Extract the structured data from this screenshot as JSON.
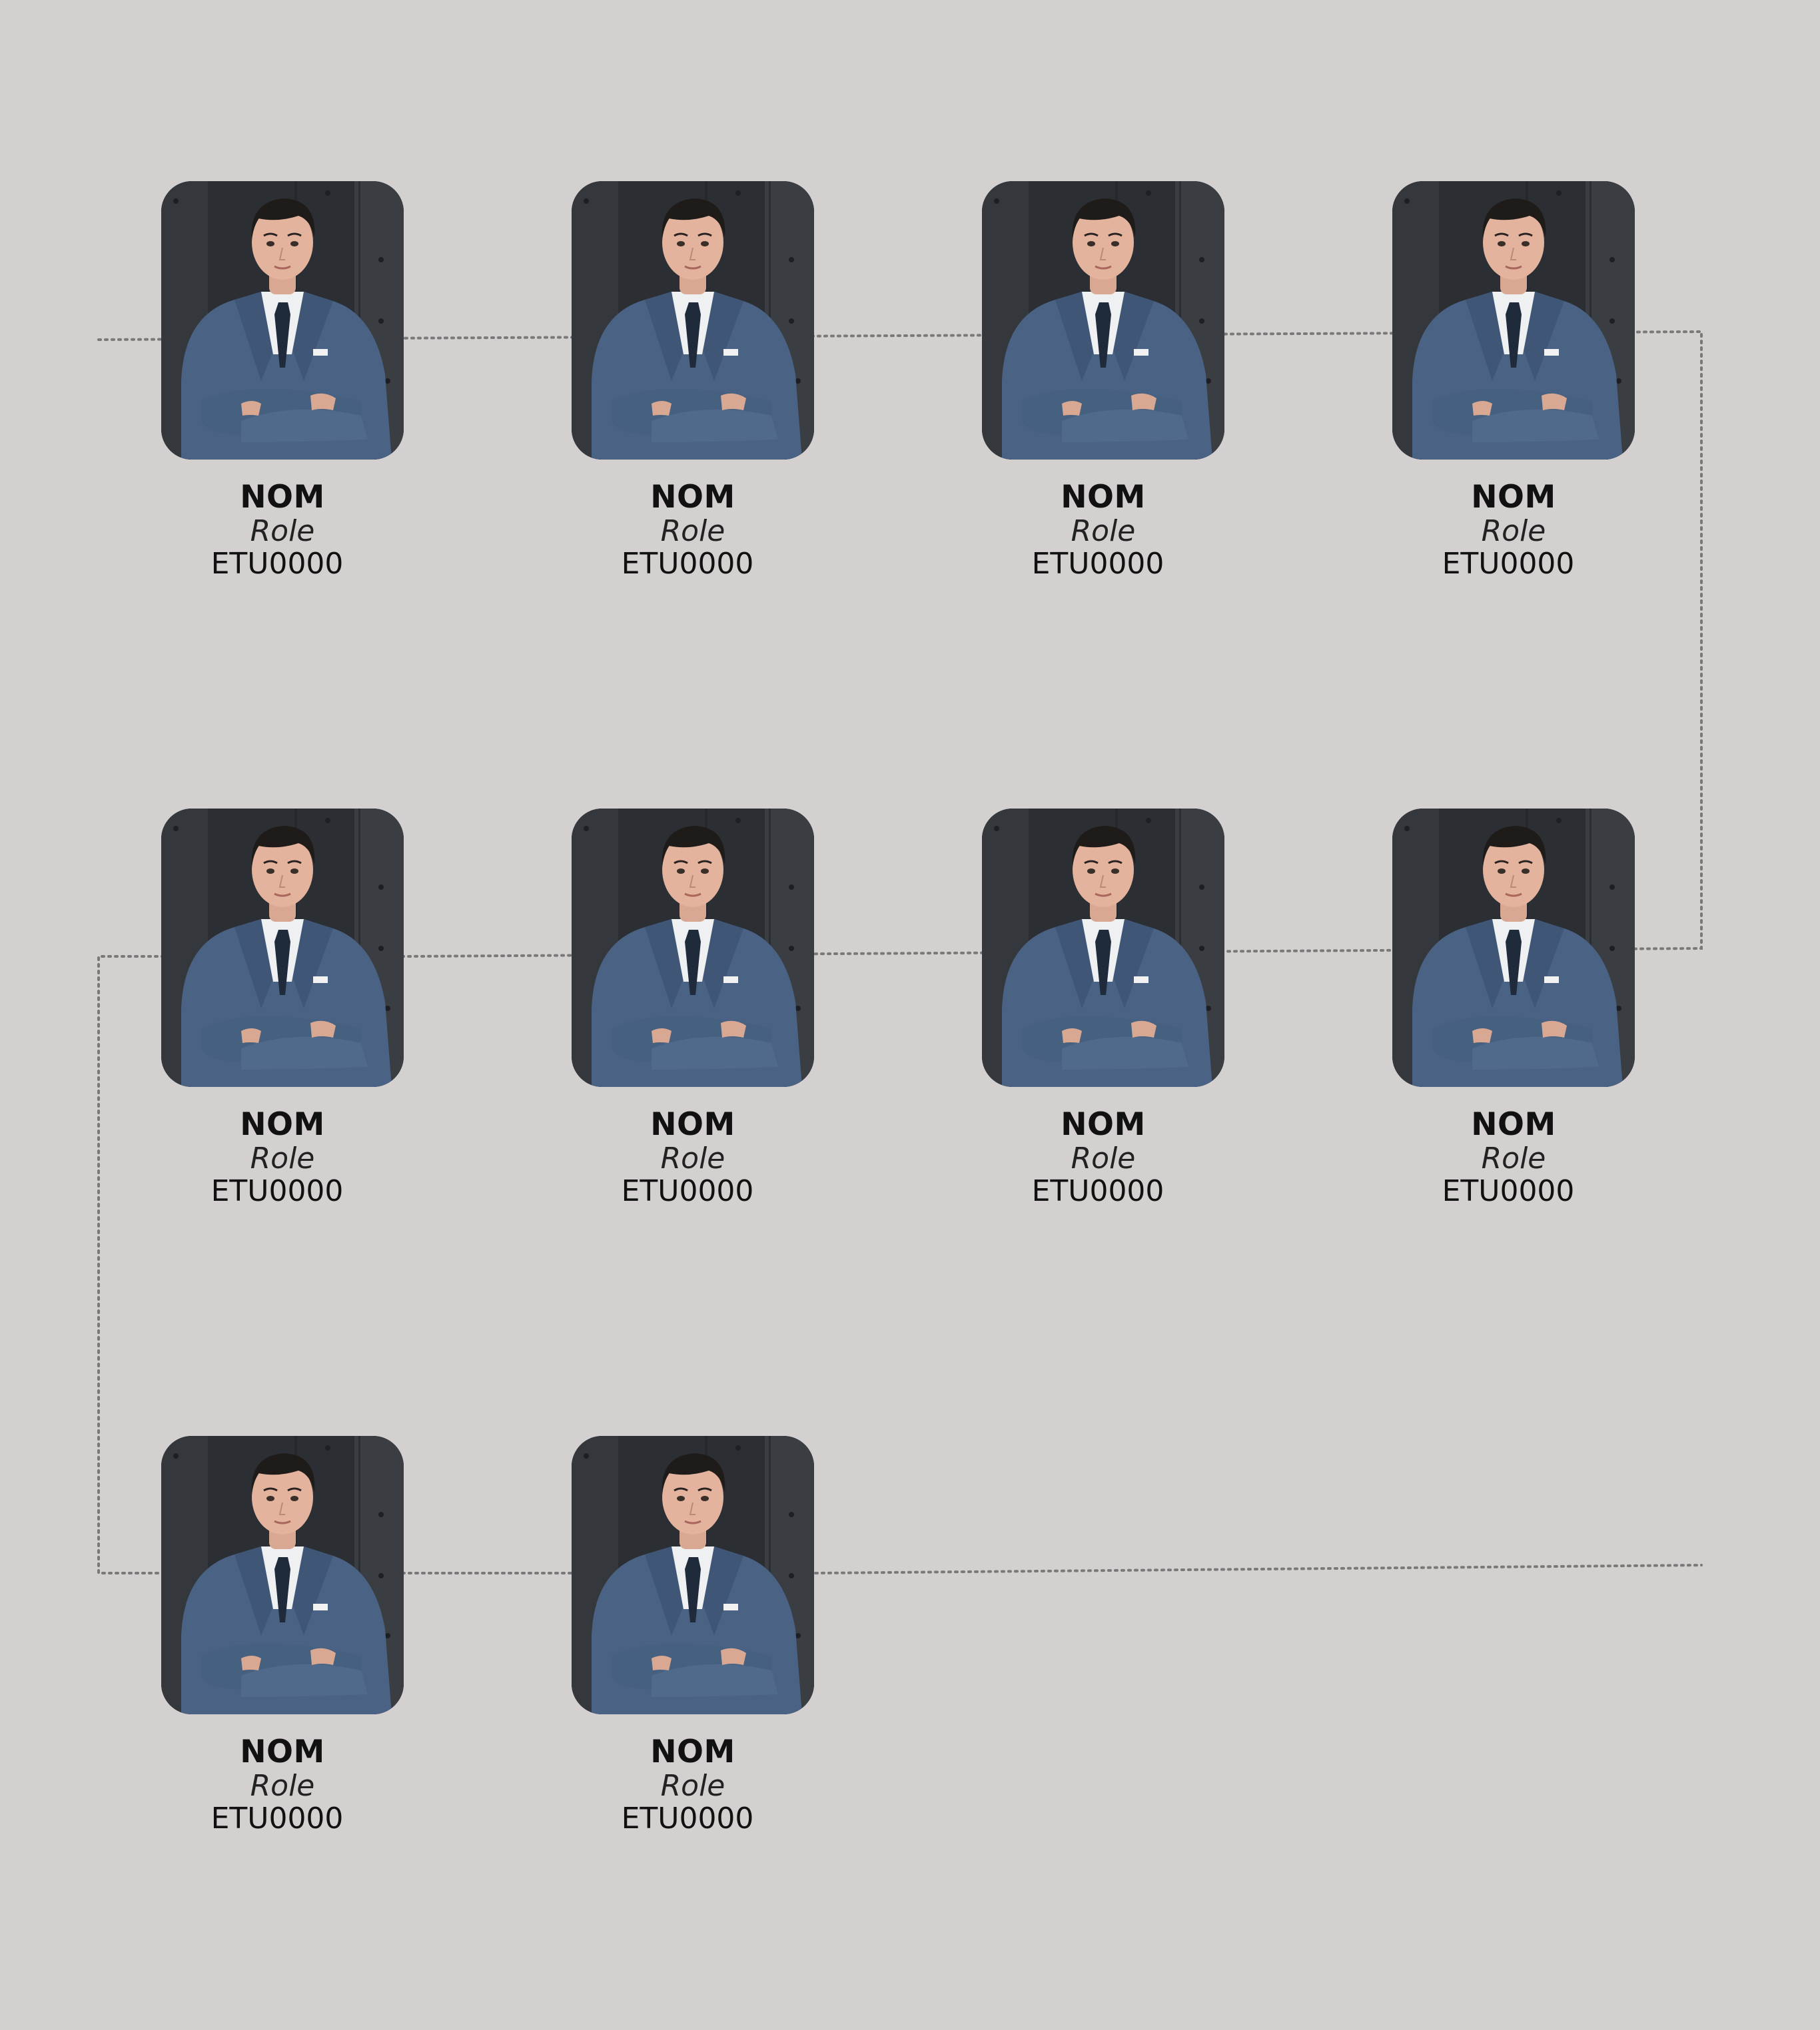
{
  "colors": {
    "background": "#d3d0cf",
    "connector": "#7a7878",
    "photo_backdrop": "#2b2e33",
    "suit": "#4a6283"
  },
  "connector_style": "dotted",
  "photo_icon": "person-portrait-icon",
  "members": [
    {
      "name": "NOM",
      "role": "Role",
      "id": "ETU0000"
    },
    {
      "name": "NOM",
      "role": "Role",
      "id": "ETU0000"
    },
    {
      "name": "NOM",
      "role": "Role",
      "id": "ETU0000"
    },
    {
      "name": "NOM",
      "role": "Role",
      "id": "ETU0000"
    },
    {
      "name": "NOM",
      "role": "Role",
      "id": "ETU0000"
    },
    {
      "name": "NOM",
      "role": "Role",
      "id": "ETU0000"
    },
    {
      "name": "NOM",
      "role": "Role",
      "id": "ETU0000"
    },
    {
      "name": "NOM",
      "role": "Role",
      "id": "ETU0000"
    },
    {
      "name": "NOM",
      "role": "Role",
      "id": "ETU0000"
    },
    {
      "name": "NOM",
      "role": "Role",
      "id": "ETU0000"
    }
  ]
}
